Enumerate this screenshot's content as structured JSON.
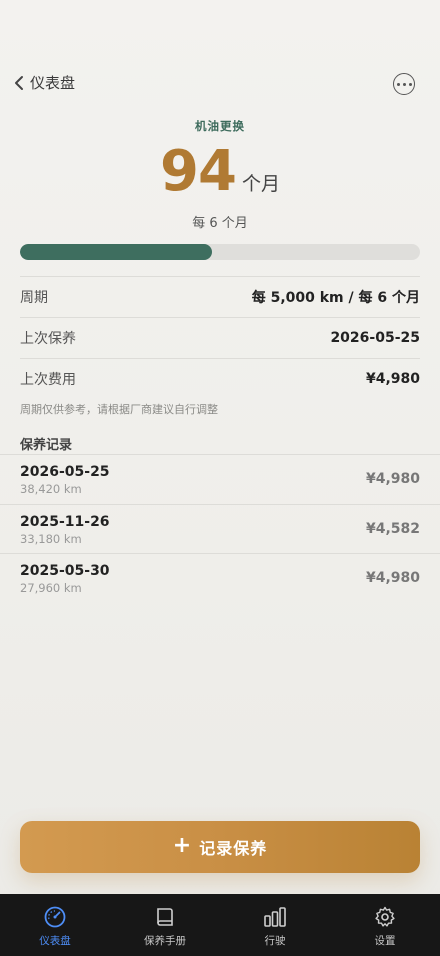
{
  "nav": {
    "back_label": "仪表盘"
  },
  "item": {
    "title": "机油更换",
    "remaining_value": "94",
    "remaining_unit": "个月",
    "interval_text": "每 6 个月"
  },
  "progress": {
    "fraction": 0.48,
    "color": "#3e6e5f"
  },
  "details": [
    {
      "label": "周期",
      "value": "每 5,000 km / 每 6 个月"
    },
    {
      "label": "上次保养",
      "value": "2026-05-25"
    },
    {
      "label": "上次费用",
      "value": "¥4,980"
    }
  ],
  "note": "周期仅供参考，请根据厂商建议自行调整",
  "records": {
    "title": "保养记录",
    "items": [
      {
        "date": "2026-05-25",
        "km": "38,420 km",
        "cost": "¥4,980"
      },
      {
        "date": "2025-11-26",
        "km": "33,180 km",
        "cost": "¥4,582"
      },
      {
        "date": "2025-05-30",
        "km": "27,960 km",
        "cost": "¥4,980"
      }
    ]
  },
  "cta": {
    "label": "记录保养",
    "icon": "plus-icon"
  },
  "tabs": [
    {
      "label": "仪表盘",
      "icon": "gauge-icon",
      "active": true
    },
    {
      "label": "保养手册",
      "icon": "book-icon",
      "active": false
    },
    {
      "label": "行驶",
      "icon": "bar-chart-icon",
      "active": false
    },
    {
      "label": "设置",
      "icon": "gear-icon",
      "active": false
    }
  ],
  "colors": {
    "accent": "#b07a33",
    "green": "#3e6e5f",
    "tab_active": "#4e8ef7"
  }
}
